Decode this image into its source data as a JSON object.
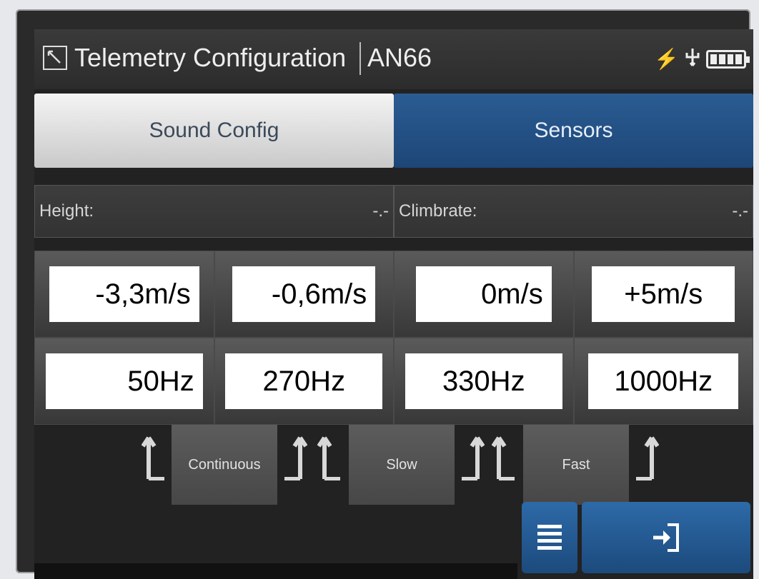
{
  "window": {
    "title": "Telemetry Configuration",
    "device": "AN66",
    "icons": [
      "app-icon",
      "flash-icon",
      "usb-icon",
      "battery-icon"
    ]
  },
  "tabs": [
    {
      "label": "Sound Config",
      "selected": true
    },
    {
      "label": "Sensors",
      "selected": false
    }
  ],
  "readouts": {
    "height": {
      "label": "Height:",
      "value": "-.-"
    },
    "climbrate": {
      "label": "Climbrate:",
      "value": "-.-"
    }
  },
  "speeds": [
    "-3,3m/s",
    "-0,6m/s",
    "0m/s",
    "+5m/s"
  ],
  "frequencies": [
    "50Hz",
    "270Hz",
    "330Hz",
    "1000Hz"
  ],
  "modes": [
    "Continuous",
    "Slow",
    "Fast"
  ],
  "buttons": {
    "menu_icon": "menu-icon",
    "exit_icon": "exit-icon"
  },
  "colors": {
    "accent": "#1d4677",
    "tab_light": "#e0e0e0",
    "background": "#222222"
  }
}
